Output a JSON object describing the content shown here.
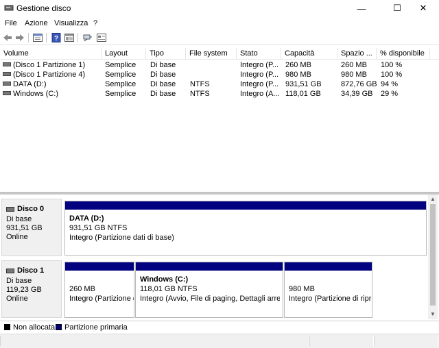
{
  "window": {
    "title": "Gestione disco",
    "minimize": "—",
    "maximize": "☐",
    "close": "✕"
  },
  "menu": [
    "File",
    "Azione",
    "Visualizza",
    "?"
  ],
  "toolbar": [
    "back-icon",
    "forward-icon",
    "properties-icon",
    "help-icon",
    "disk-view-icon",
    "connect-icon",
    "console-icon"
  ],
  "table": {
    "columns": [
      "Volume",
      "Layout",
      "Tipo",
      "File system",
      "Stato",
      "Capacità",
      "Spazio ...",
      "% disponibile"
    ],
    "rows": [
      [
        "(Disco 1 Partizione 1)",
        "Semplice",
        "Di base",
        "",
        "Integro (P...",
        "260 MB",
        "260 MB",
        "100 %"
      ],
      [
        "(Disco 1 Partizione 4)",
        "Semplice",
        "Di base",
        "",
        "Integro (P...",
        "980 MB",
        "980 MB",
        "100 %"
      ],
      [
        "DATA (D:)",
        "Semplice",
        "Di base",
        "NTFS",
        "Integro (P...",
        "931,51 GB",
        "872,76 GB",
        "94 %"
      ],
      [
        "Windows (C:)",
        "Semplice",
        "Di base",
        "NTFS",
        "Integro (A...",
        "118,01 GB",
        "34,39 GB",
        "29 %"
      ]
    ]
  },
  "disks": [
    {
      "name": "Disco 0",
      "type": "Di base",
      "size": "931,51 GB",
      "status": "Online",
      "partitions": [
        {
          "title": "DATA  (D:)",
          "size": "931,51 GB NTFS",
          "status": "Integro (Partizione dati di base)"
        }
      ]
    },
    {
      "name": "Disco 1",
      "type": "Di base",
      "size": "119,23 GB",
      "status": "Online",
      "partitions": [
        {
          "title": "",
          "size": "260 MB",
          "status": "Integro (Partizione d"
        },
        {
          "title": "Windows  (C:)",
          "size": "118,01 GB NTFS",
          "status": "Integro (Avvio, File di paging, Dettagli arresto"
        },
        {
          "title": "",
          "size": "980 MB",
          "status": "Integro (Partizione di ripri"
        }
      ]
    }
  ],
  "legend": [
    {
      "label": "Non allocata",
      "color": "#000000"
    },
    {
      "label": "Partizione primaria",
      "color": "#02017f"
    }
  ]
}
